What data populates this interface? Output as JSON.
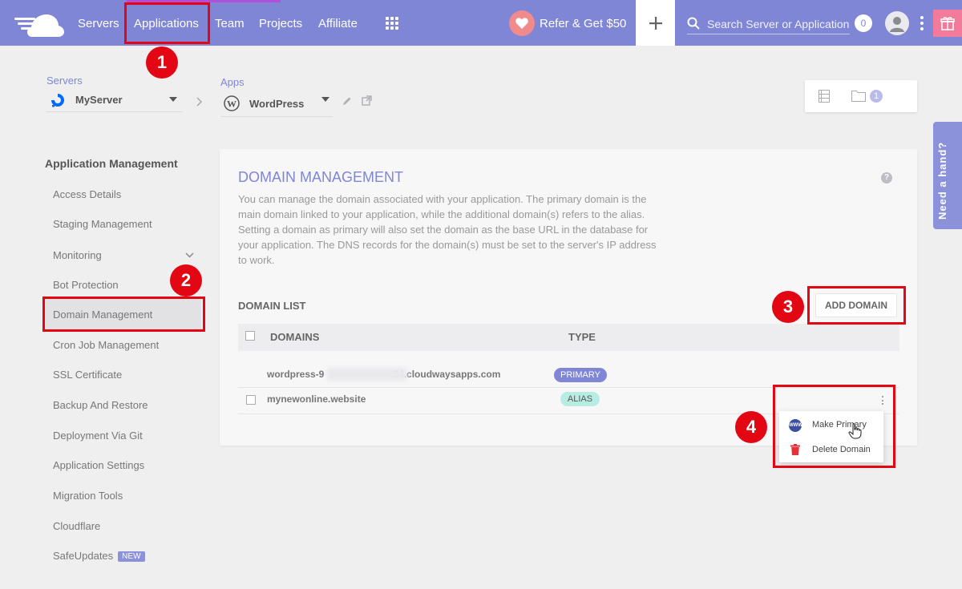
{
  "nav": {
    "items": [
      "Servers",
      "Applications",
      "Team",
      "Projects",
      "Affiliate"
    ],
    "refer_label": "Refer & Get $50",
    "search_placeholder": "Search Server or Application",
    "notification_count": "0"
  },
  "breadcrumb": {
    "servers_label": "Servers",
    "server_name": "MyServer",
    "apps_label": "Apps",
    "app_name": "WordPress",
    "folder_count": "1"
  },
  "help_tab": "Need a hand?",
  "sidebar": {
    "title": "Application Management",
    "items": [
      {
        "label": "Access Details"
      },
      {
        "label": "Staging Management"
      },
      {
        "label": "Monitoring"
      },
      {
        "label": "Bot Protection"
      },
      {
        "label": "Domain Management"
      },
      {
        "label": "Cron Job Management"
      },
      {
        "label": "SSL Certificate"
      },
      {
        "label": "Backup And Restore"
      },
      {
        "label": "Deployment Via Git"
      },
      {
        "label": "Application Settings"
      },
      {
        "label": "Migration Tools"
      },
      {
        "label": "Cloudflare"
      },
      {
        "label": "SafeUpdates",
        "badge": "NEW"
      }
    ]
  },
  "domain_management": {
    "title": "DOMAIN MANAGEMENT",
    "description": "You can manage the domain associated with your application. The primary domain is the main domain linked to your application, while the additional domain(s) refers to the alias. Setting a domain as primary will also set the domain as the base URL in the database for your application. The DNS records for the domain(s) must be set to the server's IP address to work.",
    "list_title": "DOMAIN LIST",
    "add_button": "ADD DOMAIN",
    "columns": [
      "DOMAINS",
      "TYPE"
    ],
    "rows": [
      {
        "domain_start": "wordpress-9",
        "domain_end": "34.cloudwaysapps.com",
        "type": "PRIMARY"
      },
      {
        "domain": "mynewonline.website",
        "type": "ALIAS"
      }
    ],
    "menu": [
      "Make Primary",
      "Delete Domain"
    ]
  },
  "annotations": [
    "1",
    "2",
    "3",
    "4"
  ],
  "colors": {
    "nav_bg": "#7f86d6",
    "accent": "#7f86d6",
    "annotation_red": "#e30613",
    "primary_badge": "#7f86d6",
    "alias_badge": "#b7ece3"
  }
}
